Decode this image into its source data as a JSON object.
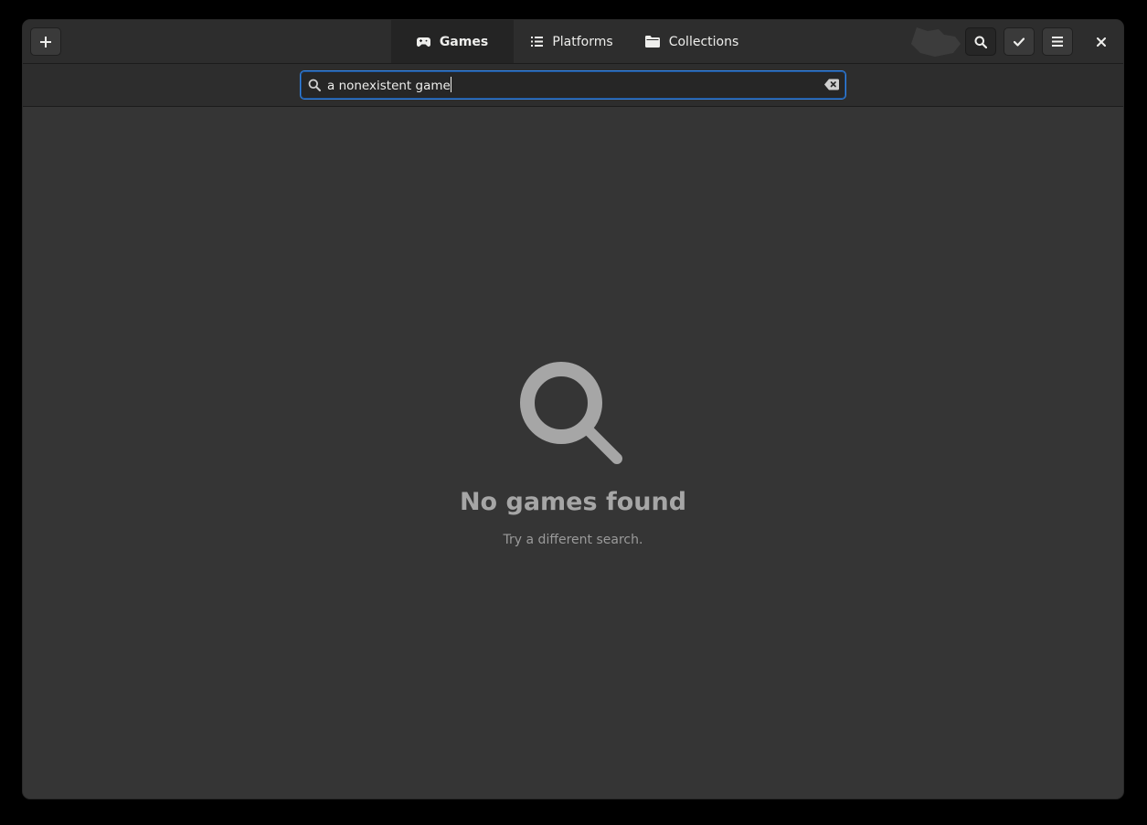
{
  "header": {
    "tabs": [
      {
        "label": "Games",
        "icon": "gamepad-icon",
        "selected": true
      },
      {
        "label": "Platforms",
        "icon": "list-icon",
        "selected": false
      },
      {
        "label": "Collections",
        "icon": "folder-icon",
        "selected": false
      }
    ],
    "buttons": {
      "add": "plus-icon",
      "search": "search-icon",
      "select": "checkmark-icon",
      "menu": "hamburger-menu-icon",
      "close": "close-icon"
    }
  },
  "search": {
    "value": "a nonexistent game",
    "placeholder": ""
  },
  "empty_state": {
    "icon": "search-icon",
    "title": "No games found",
    "description": "Try a different search."
  },
  "colors": {
    "window_bg": "#353535",
    "headerbar_bg": "#2d2d2d",
    "accent": "#3584e4",
    "text": "#eeeeec",
    "dim_text": "#a6a6a6"
  }
}
